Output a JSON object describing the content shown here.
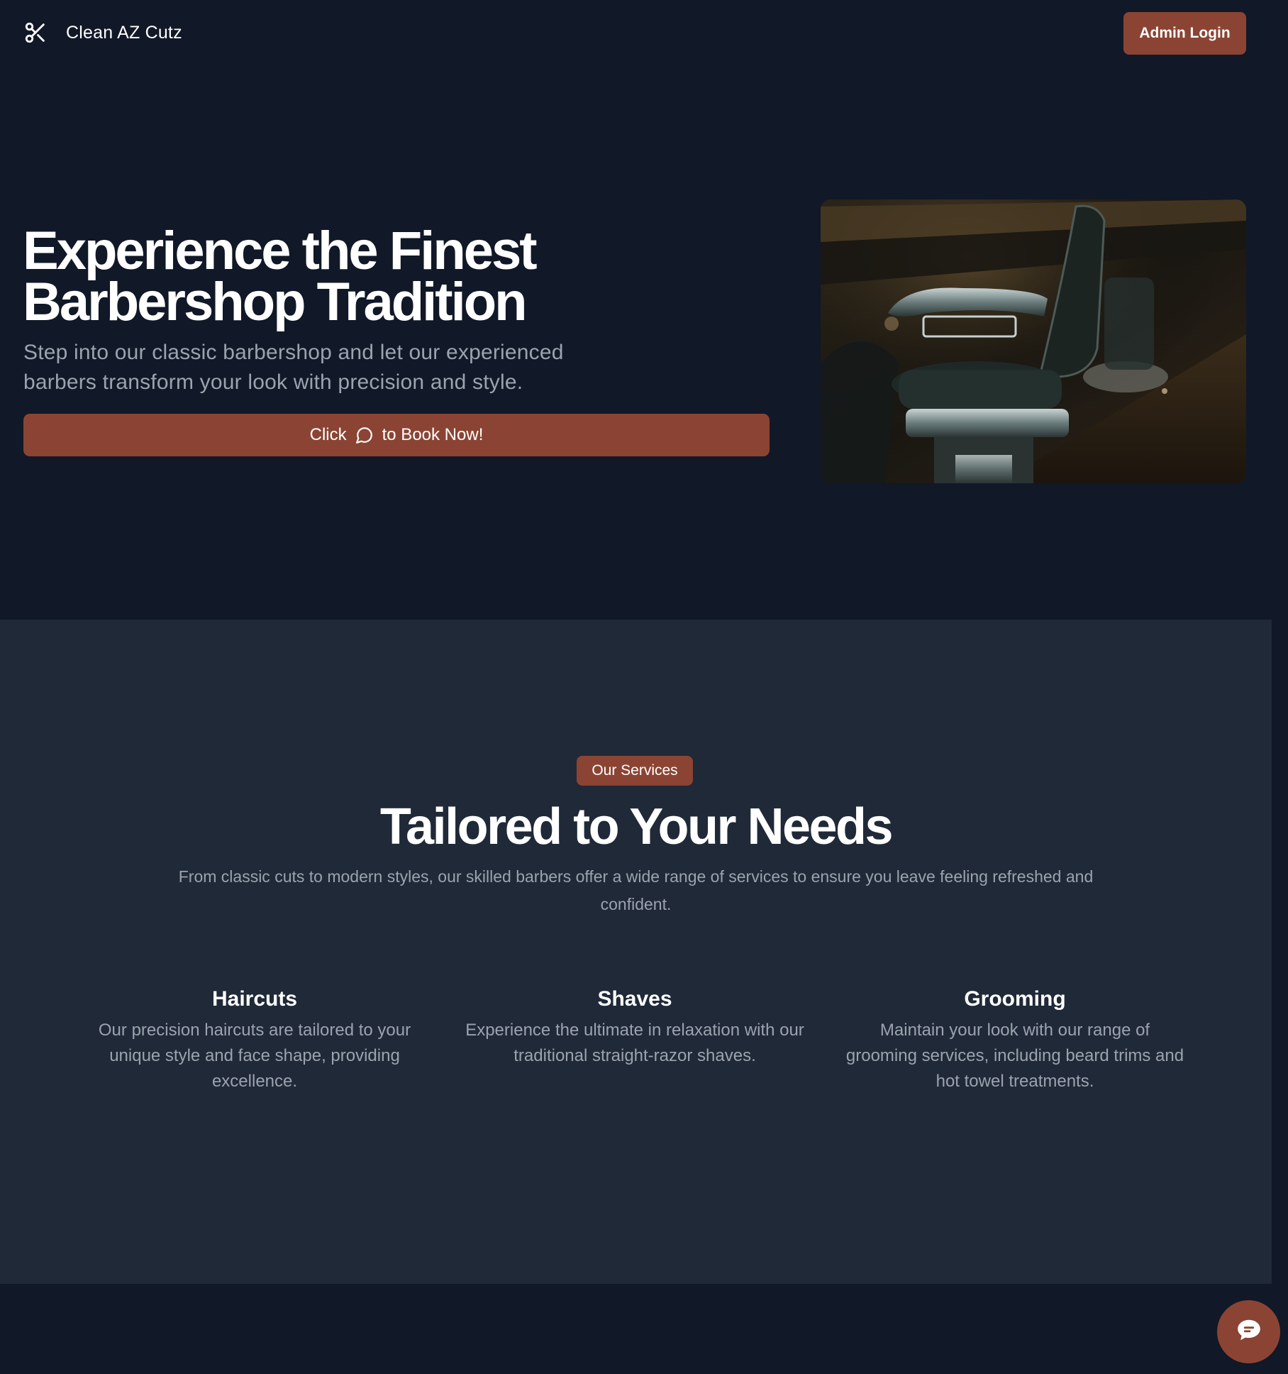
{
  "header": {
    "brand_icon": "scissors-icon",
    "brand_name": "Clean AZ Cutz",
    "admin_button": "Admin Login"
  },
  "hero": {
    "title_line1": "Experience the Finest",
    "title_line2": "Barbershop Tradition",
    "subtitle": "Step into our classic barbershop and let our experienced barbers transform your look with precision and style.",
    "book_prefix": "Click",
    "book_icon": "message-circle-icon",
    "book_suffix": "to Book Now!",
    "image": "barber-chair-photo"
  },
  "services": {
    "badge": "Our Services",
    "title": "Tailored to Your Needs",
    "subtitle": "From classic cuts to modern styles, our skilled barbers offer a wide range of services to ensure you leave feeling refreshed and confident.",
    "items": [
      {
        "title": "Haircuts",
        "description": "Our precision haircuts are tailored to your unique style and face shape, providing excellence."
      },
      {
        "title": "Shaves",
        "description": "Experience the ultimate in relaxation with our traditional straight-razor shaves."
      },
      {
        "title": "Grooming",
        "description": "Maintain your look with our range of grooming services, including beard trims and hot towel treatments."
      }
    ]
  },
  "chat_widget": {
    "icon": "chat-bubble-icon"
  },
  "colors": {
    "background": "#111827",
    "section_background": "#1f2937",
    "accent": "#8b4433",
    "muted_text": "#9ca3af"
  }
}
